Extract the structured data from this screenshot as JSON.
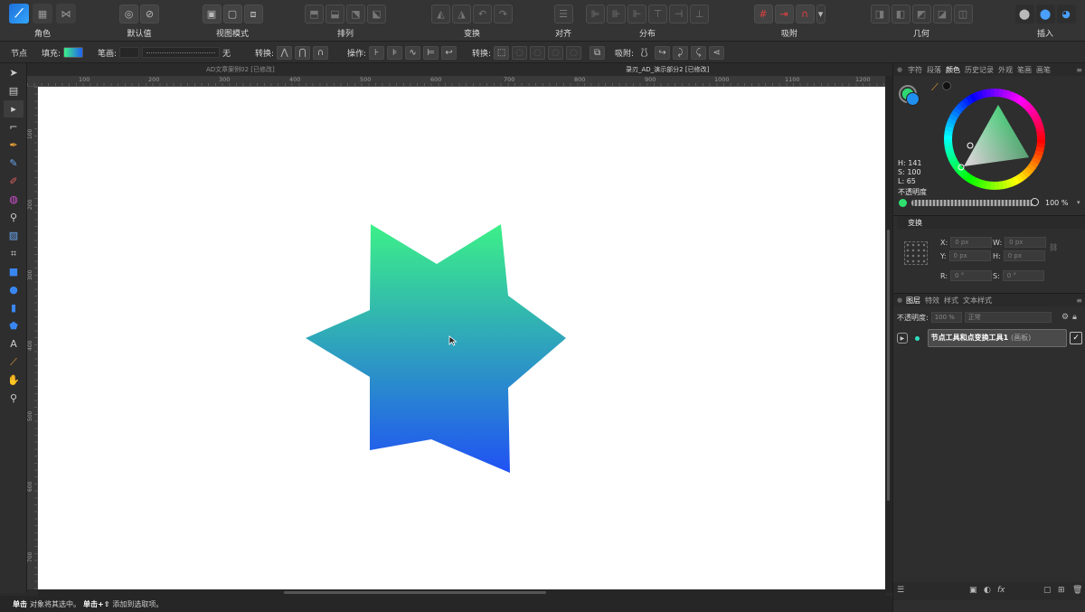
{
  "toolbar": {
    "persona_label": "角色",
    "groups": [
      {
        "id": "defaults",
        "label": "默认值"
      },
      {
        "id": "view-mode",
        "label": "视图模式"
      },
      {
        "id": "arrange",
        "label": "排列"
      },
      {
        "id": "transform",
        "label": "变换"
      },
      {
        "id": "align",
        "label": "对齐"
      },
      {
        "id": "distribute",
        "label": "分布"
      },
      {
        "id": "snapping",
        "label": "吸附"
      },
      {
        "id": "geometry",
        "label": "几何"
      },
      {
        "id": "insert",
        "label": "插入"
      }
    ]
  },
  "contextbar": {
    "tool_label": "节点",
    "fill_label": "填充:",
    "stroke_label": "笔画:",
    "stroke_none": "无",
    "convert_label": "转换:",
    "action_label": "操作:",
    "transform_label": "转换:",
    "snap_label": "吸附:"
  },
  "documents": {
    "tab1": "AD文章案例02 [已修改]",
    "tab2": "录刃_AD_演示部分2 [已修改]"
  },
  "ruler": {
    "h_ticks": [
      "100",
      "200",
      "300",
      "400",
      "500",
      "600",
      "700",
      "800",
      "900",
      "1000",
      "1100",
      "1200"
    ],
    "v_ticks": [
      "100",
      "200",
      "300",
      "400",
      "500",
      "600",
      "700"
    ]
  },
  "canvas": {
    "shape": "six-point star",
    "gradient": {
      "top": "#3cf088",
      "bottom": "#2052f4"
    }
  },
  "status": {
    "click": "单击",
    "text1": "对象将其选中。",
    "shift_click": "单击+⇧",
    "text2": "添加到选取项。"
  },
  "color_panel": {
    "tabs": [
      "字符",
      "段落",
      "颜色",
      "历史记录",
      "外观",
      "笔画",
      "画笔"
    ],
    "active_tab": "颜色",
    "h": "H: 141",
    "s": "S: 100",
    "l": "L: 65",
    "opacity_label": "不透明度",
    "opacity_value": "100 %",
    "current_color": "#2fe070"
  },
  "transform_panel": {
    "title": "变换",
    "x_label": "X:",
    "x_value": "0 px",
    "y_label": "Y:",
    "y_value": "0 px",
    "w_label": "W:",
    "w_value": "0 px",
    "h_label": "H:",
    "h_value": "0 px",
    "r_label": "R:",
    "r_value": "0 °",
    "s_label": "S:",
    "s_value": "0 °"
  },
  "layers_panel": {
    "tabs": [
      "图层",
      "特效",
      "样式",
      "文本样式"
    ],
    "active_tab": "图层",
    "opacity_label": "不透明度:",
    "opacity_value": "100 %",
    "blend_mode": "正常",
    "layer_name": "节点工具和点变换工具1",
    "layer_type": "(画板)"
  }
}
